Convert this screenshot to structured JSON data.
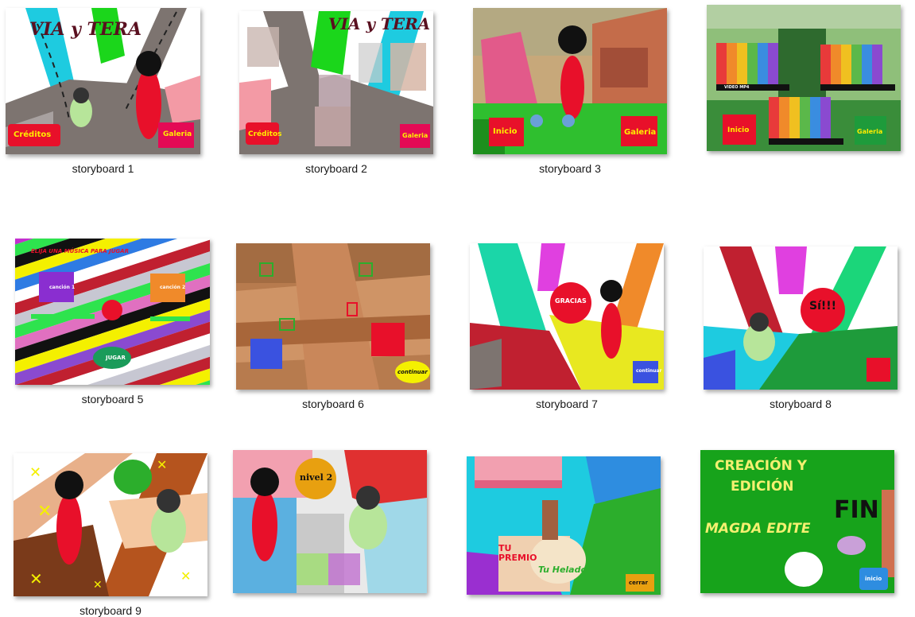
{
  "captions": {
    "sb1": "storyboard 1",
    "sb2": "storyboard 2",
    "sb3": "storyboard 3",
    "sb5": "storyboard 5",
    "sb6": "storyboard 6",
    "sb7": "storyboard 7",
    "sb8": "storyboard 8",
    "sb9": "storyboard 9"
  },
  "sb1": {
    "title": "VIA y TERA",
    "btn_left": "Créditos",
    "btn_right": "Galeria"
  },
  "sb2": {
    "title": "VIA y TERA",
    "btn_left": "Créditos",
    "btn_right": "Galeria"
  },
  "sb3": {
    "btn_left": "Inicio",
    "btn_right": "Galeria"
  },
  "sb4": {
    "btn_left": "Inicio",
    "btn_right": "Galeria",
    "video_label": "VIDEO MP4"
  },
  "sb5": {
    "heading": "ELIJA UNA MÚSICA PARA JUGAR",
    "music1": "canción 1",
    "music2": "canción 2",
    "play": "JUGAR"
  },
  "sb6": {
    "continue": "continuar"
  },
  "sb7": {
    "bubble": "GRACIAS",
    "continue": "continuar"
  },
  "sb8": {
    "bubble": "Sí!!!"
  },
  "sb10": {
    "level": "nivel 2"
  },
  "sb11": {
    "prize": "TU PREMIO",
    "helado": "Tu Helado",
    "btn": "cerrar"
  },
  "sb12": {
    "line1": "CREACIÓN Y",
    "line2": "EDICIÓN",
    "author": "MAGDA EDITE",
    "fin": "FIN",
    "btn": "inicio"
  },
  "colors": {
    "green": "#17a31b",
    "red": "#e8102a",
    "road": "#7d7470",
    "stripe_yellow": "#f4f000"
  }
}
